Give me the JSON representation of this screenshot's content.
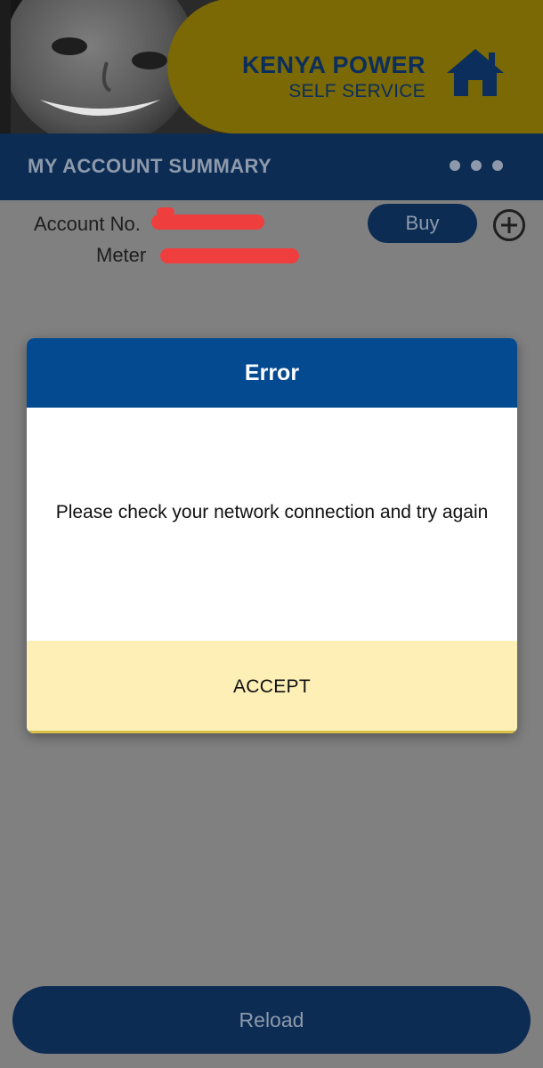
{
  "header": {
    "brand_title": "KENYA POWER",
    "brand_subtitle": "SELF SERVICE",
    "home_icon": "home-icon",
    "colors": {
      "pill": "#7a6905",
      "brand_text": "#0b2e5c"
    }
  },
  "summary": {
    "title": "MY ACCOUNT SUMMARY",
    "more_icon": "more-dots-icon"
  },
  "account": {
    "account_label": "Account No.",
    "meter_label": "Meter",
    "buy_label": "Buy",
    "add_icon": "plus-circle-icon"
  },
  "dialog": {
    "title": "Error",
    "message": "Please check your network connection and try again",
    "accept_label": "ACCEPT",
    "colors": {
      "header": "#044a91",
      "button": "#fdefb6"
    }
  },
  "footer": {
    "reload_label": "Reload"
  }
}
